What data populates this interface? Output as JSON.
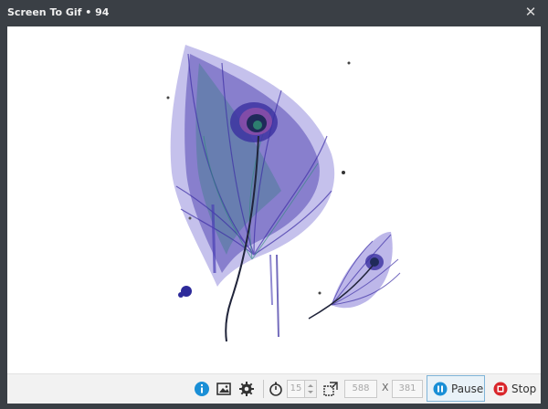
{
  "window": {
    "title": "Screen To Gif • 94",
    "close_icon": "close-icon"
  },
  "toolbar": {
    "info_icon": "info-icon",
    "image_icon": "image-icon",
    "settings_icon": "gear-icon",
    "timer_icon": "stopwatch-icon",
    "fps": {
      "value": "15",
      "placeholder": "15"
    },
    "size_icon": "resize-icon",
    "width": "588",
    "x_label": "X",
    "height": "381",
    "pause_label": "Pause",
    "stop_label": "Stop"
  },
  "colors": {
    "window_frame": "#3a3f45",
    "toolbar_bg": "#f2f2f2",
    "accent_blue": "#1a8fd6",
    "stop_red": "#d9252a",
    "feather_purple": "#4a3fb5",
    "feather_teal": "#2d8a7a"
  }
}
